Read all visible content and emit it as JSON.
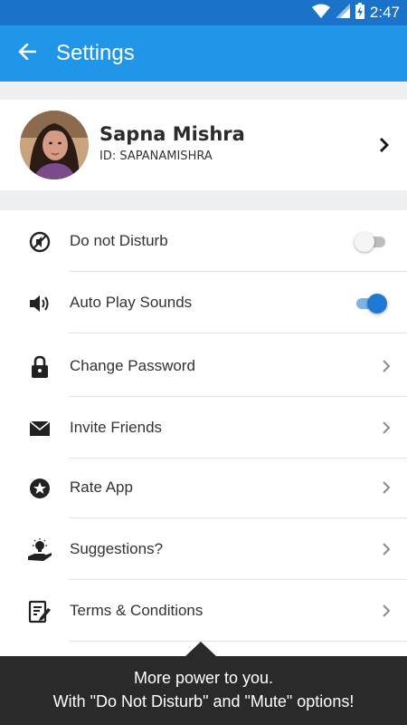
{
  "status_bar": {
    "time": "2:47",
    "wifi_icon": "wifi-icon",
    "signal_icon": "signal-icon",
    "battery_icon": "battery-charging-icon"
  },
  "app_bar": {
    "title": "Settings",
    "back_icon": "back-arrow-icon"
  },
  "profile": {
    "name": "Sapna Mishra",
    "id": "ID: SAPANAMISHRA",
    "avatar_icon": "avatar"
  },
  "settings": [
    {
      "label": "Do not Disturb",
      "icon": "do-not-disturb-icon",
      "control": "toggle",
      "enabled": false
    },
    {
      "label": "Auto Play Sounds",
      "icon": "speaker-icon",
      "control": "toggle",
      "enabled": true
    },
    {
      "label": "Change Password",
      "icon": "lock-icon",
      "control": "chevron"
    },
    {
      "label": "Invite Friends",
      "icon": "envelope-icon",
      "control": "chevron"
    },
    {
      "label": "Rate App",
      "icon": "star-badge-icon",
      "control": "chevron"
    },
    {
      "label": "Suggestions?",
      "icon": "lightbulb-hand-icon",
      "control": "chevron"
    },
    {
      "label": "Terms & Conditions",
      "icon": "document-edit-icon",
      "control": "chevron"
    }
  ],
  "tooltip": {
    "line1": "More power to you.",
    "line2": "With \"Do Not Disturb\" and \"Mute\" options!"
  },
  "colors": {
    "status_bar": "#1a73c9",
    "app_bar": "#2196e8",
    "toggle_on": "#1f78d1",
    "toggle_on_track": "#7fb3e6",
    "toggle_off_thumb": "#f5f5f5",
    "toggle_off_track": "#bdbdbd",
    "tooltip_bg": "#2a2a2a"
  }
}
